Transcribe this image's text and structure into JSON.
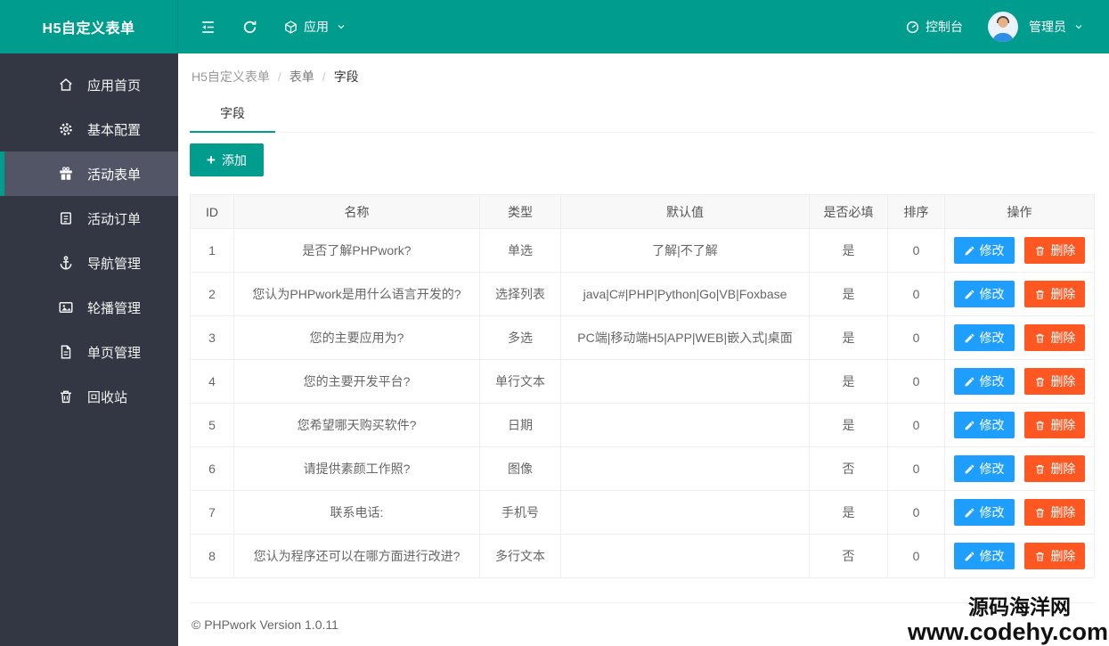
{
  "header": {
    "brand": "H5自定义表单",
    "app_menu": "应用",
    "console": "控制台",
    "user": "管理员"
  },
  "sidebar": {
    "items": [
      {
        "label": "应用首页",
        "icon": "home-icon",
        "active": false
      },
      {
        "label": "基本配置",
        "icon": "gear-icon",
        "active": false
      },
      {
        "label": "活动表单",
        "icon": "gift-icon",
        "active": true
      },
      {
        "label": "活动订单",
        "icon": "order-icon",
        "active": false
      },
      {
        "label": "导航管理",
        "icon": "anchor-icon",
        "active": false
      },
      {
        "label": "轮播管理",
        "icon": "image-icon",
        "active": false
      },
      {
        "label": "单页管理",
        "icon": "page-icon",
        "active": false
      },
      {
        "label": "回收站",
        "icon": "trash-icon",
        "active": false
      }
    ]
  },
  "breadcrumb": {
    "items": [
      "H5自定义表单",
      "表单",
      "字段"
    ],
    "separator": "/"
  },
  "tab": {
    "label": "字段"
  },
  "toolbar": {
    "add_icon": "+",
    "add_label": "添加"
  },
  "table": {
    "headers": {
      "id": "ID",
      "name": "名称",
      "type": "类型",
      "default": "默认值",
      "required": "是否必填",
      "sort": "排序",
      "op": "操作"
    },
    "actions": {
      "edit": "修改",
      "delete": "删除"
    },
    "rows": [
      {
        "id": "1",
        "name": "是否了解PHPwork?",
        "type": "单选",
        "default": "了解|不了解",
        "required": "是",
        "sort": "0"
      },
      {
        "id": "2",
        "name": "您认为PHPwork是用什么语言开发的?",
        "type": "选择列表",
        "default": "java|C#|PHP|Python|Go|VB|Foxbase",
        "required": "是",
        "sort": "0"
      },
      {
        "id": "3",
        "name": "您的主要应用为?",
        "type": "多选",
        "default": "PC端|移动端H5|APP|WEB|嵌入式|桌面",
        "required": "是",
        "sort": "0"
      },
      {
        "id": "4",
        "name": "您的主要开发平台?",
        "type": "单行文本",
        "default": "",
        "required": "是",
        "sort": "0"
      },
      {
        "id": "5",
        "name": "您希望哪天购买软件?",
        "type": "日期",
        "default": "",
        "required": "是",
        "sort": "0"
      },
      {
        "id": "6",
        "name": "请提供素颜工作照?",
        "type": "图像",
        "default": "",
        "required": "否",
        "sort": "0"
      },
      {
        "id": "7",
        "name": "联系电话:",
        "type": "手机号",
        "default": "",
        "required": "是",
        "sort": "0"
      },
      {
        "id": "8",
        "name": "您认为程序还可以在哪方面进行改进?",
        "type": "多行文本",
        "default": "",
        "required": "否",
        "sort": "0"
      }
    ]
  },
  "footer": {
    "copyright": "© PHPwork Version 1.0.11"
  },
  "watermark": {
    "line1": "源码海洋网",
    "line2": "www.codehy.com"
  },
  "colors": {
    "green": "#009c8e",
    "sidebar-bg": "#333744",
    "sidebar-active-bg": "#515566",
    "blue": "#1E9FFF",
    "orange": "#FF5722"
  }
}
